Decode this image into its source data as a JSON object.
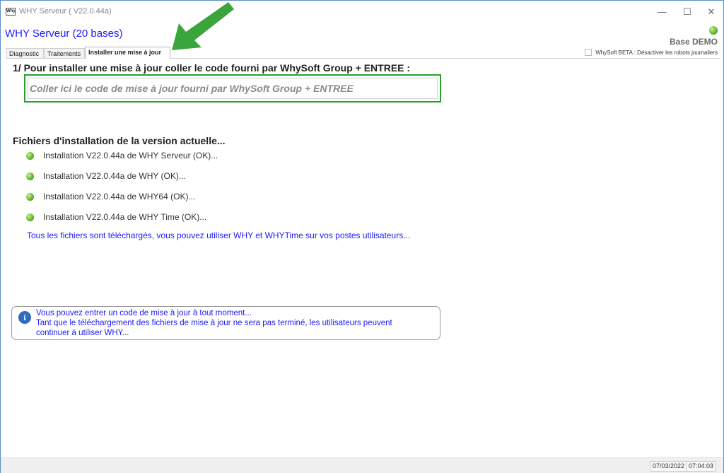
{
  "window": {
    "icon_text": "Why",
    "title": "WHY Serveur ( V22.0.44a)",
    "controls": {
      "minimize": "—",
      "maximize": "☐",
      "close": "✕"
    }
  },
  "header": {
    "app_title": "WHY Serveur (20 bases)",
    "base_label": "Base DEMO",
    "beta_option": "WhySoft BETA : Désactiver les robots journaliers"
  },
  "tabs": [
    {
      "label": "Diagnostic",
      "active": false
    },
    {
      "label": "Traitements",
      "active": false
    },
    {
      "label": "Installer une mise à jour",
      "active": true
    }
  ],
  "install": {
    "heading": "1/ Pour installer une mise à jour coller le code fourni par WhySoft Group + ENTREE :",
    "code_placeholder": "Coller ici le code de mise à jour fourni par WhySoft Group + ENTREE"
  },
  "files": {
    "heading": "Fichiers d'installation de la version actuelle...",
    "items": [
      {
        "label": "Installation V22.0.44a de WHY Serveur (OK)..."
      },
      {
        "label": "Installation V22.0.44a de WHY (OK)..."
      },
      {
        "label": "Installation V22.0.44a de WHY64 (OK)..."
      },
      {
        "label": "Installation V22.0.44a de WHY Time (OK)..."
      }
    ],
    "note": "Tous les fichiers sont téléchargés, vous pouvez utiliser WHY et WHYTime sur vos postes utilisateurs..."
  },
  "info": {
    "icon": "i",
    "line1": "Vous pouvez entrer un code de mise à jour à tout moment...",
    "line2": "Tant que le téléchargement des fichiers de mise à jour ne sera pas terminé, les utilisateurs peuvent",
    "line3": "continuer à utiliser WHY..."
  },
  "statusbar": {
    "date": "07/03/2022",
    "time": "07:04:03"
  },
  "colors": {
    "accent_blue": "#1a1aff",
    "frame_green": "#2aa02a",
    "arrow_green": "#3aa53a",
    "status_green": "#5bb52a"
  }
}
